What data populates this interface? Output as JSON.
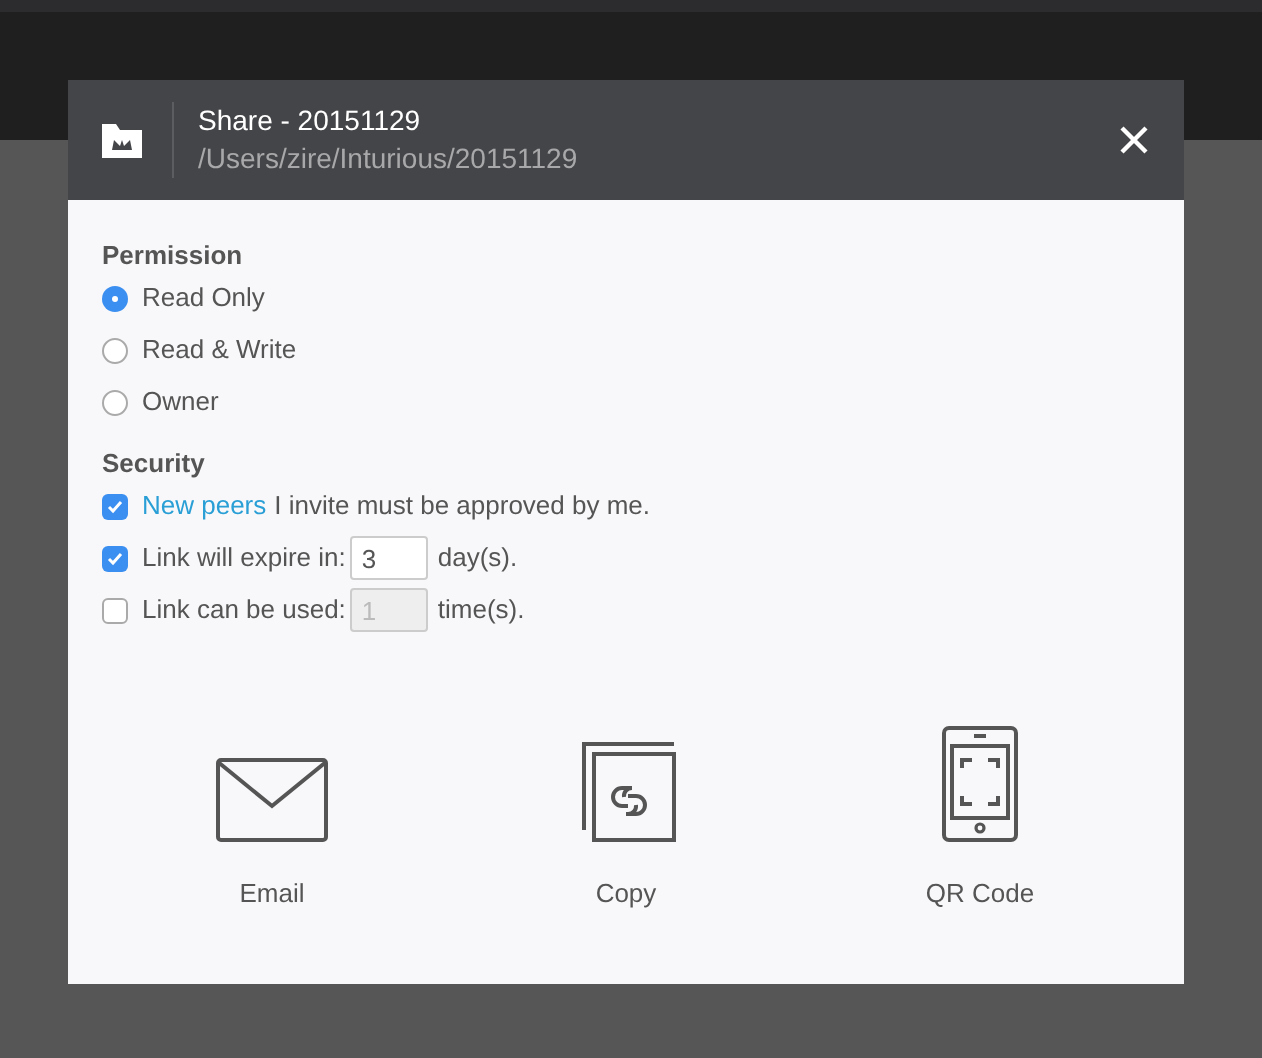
{
  "dialog": {
    "title": "Share - 20151129",
    "path": "/Users/zire/Inturious/20151129"
  },
  "permission": {
    "heading": "Permission",
    "options": [
      {
        "label": "Read Only",
        "selected": true
      },
      {
        "label": "Read & Write",
        "selected": false
      },
      {
        "label": "Owner",
        "selected": false
      }
    ]
  },
  "security": {
    "heading": "Security",
    "options": [
      {
        "kind": "link",
        "link": "New peers",
        "text": "I invite must be approved by me.",
        "checked": true
      },
      {
        "kind": "input",
        "text": "Link will expire in:",
        "value": "3",
        "unit": "day(s).",
        "checked": true,
        "disabled": false
      },
      {
        "kind": "input",
        "text": "Link can be used:",
        "value": "1",
        "unit": "time(s).",
        "checked": false,
        "disabled": true
      }
    ]
  },
  "share_methods": [
    {
      "kind": "email",
      "label": "Email"
    },
    {
      "kind": "copy",
      "label": "Copy"
    },
    {
      "kind": "qr",
      "label": "QR Code"
    }
  ]
}
